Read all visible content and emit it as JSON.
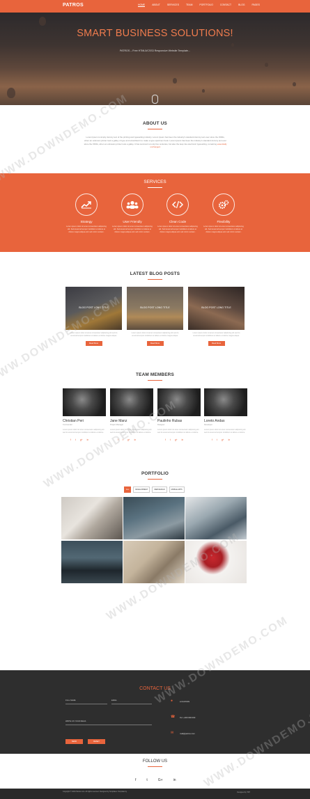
{
  "nav": {
    "logo": "PATROS",
    "links": [
      "HOME",
      "ABOUT",
      "SERVICES",
      "TEAM",
      "PORTFOLIO",
      "CONTACT",
      "BLOG",
      "PAGES"
    ]
  },
  "hero": {
    "title": "SMART BUSINESS SOLUTIONS!",
    "subtitle": "PATROS – Free HTML5/CSS3 Responsive Website Template..."
  },
  "about": {
    "title": "ABOUT US",
    "text": "Lorem Ipsum is simply dummy text of the printing and typesetting industry. Lorem Ipsum has been the industry's standard dummy text ever since the 1500s, when an unknown printer took a galley of type and scrambled it to make a type specimen book. Lorem Ipsum has been the industry's standard dummy text ever since the 1500s, when an unknown printer took a galley. It has survived not only five centuries, but also the leap into electronic typesetting, remaining",
    "link": "essentially unchanged."
  },
  "services": {
    "title": "SERVICES",
    "items": [
      {
        "icon": "chart-line-icon",
        "title": "Strategy",
        "text": "Lorem ipsum dolor sit amet consectetur adipiscing elit. Sed eiusmod tempor incididunt ut labore et dolore magna aliqua enim ad minim veniam."
      },
      {
        "icon": "users-icon",
        "title": "User Friendly",
        "text": "Lorem ipsum dolor sit amet consectetur adipiscing elit. Sed eiusmod tempor incididunt ut labore et dolore magna aliqua enim ad minim veniam."
      },
      {
        "icon": "code-icon",
        "title": "Clean Code",
        "text": "Lorem ipsum dolor sit amet consectetur adipiscing elit. Sed eiusmod tempor incididunt ut labore et dolore magna aliqua enim ad minim veniam."
      },
      {
        "icon": "gears-icon",
        "title": "Flexibility",
        "text": "Lorem ipsum dolor sit amet consectetur adipiscing elit. Sed eiusmod tempor incididunt ut labore et dolore magna aliqua enim ad minim veniam."
      }
    ]
  },
  "blog": {
    "title": "LATEST BLOG POSTS",
    "posts": [
      {
        "title": "BLOG POST LONG TITLE",
        "text": "Lorem ipsum dolor sit amet consectetur adipiscing elit sed do eiusmod tempor incididunt ut labore et dolore magna aliqua.",
        "button": "Read More"
      },
      {
        "title": "BLOG POST LONG TITLE",
        "text": "Lorem ipsum dolor sit amet consectetur adipiscing elit sed do eiusmod tempor incididunt ut labore et dolore magna aliqua.",
        "button": "Read More"
      },
      {
        "title": "BLOG POST LONG TITLE",
        "text": "Lorem ipsum dolor sit amet consectetur adipiscing elit sed do eiusmod tempor incididunt ut labore et dolore magna aliqua.",
        "button": "Read More"
      }
    ]
  },
  "team": {
    "title": "TEAM MEMBERS",
    "members": [
      {
        "name": "Christian Peri",
        "role": "Co-Founder",
        "text": "Lorem ipsum dolor sit amet consectetur adipiscing elit sed do eiusmod tempor incididunt ut labore et dolore."
      },
      {
        "name": "Jane Manz",
        "role": "Project Manager",
        "text": "Lorem ipsum dolor sit amet consectetur adipiscing elit sed do eiusmod tempor incididunt ut labore et dolore."
      },
      {
        "name": "Paulinho Rubas",
        "role": "Designer",
        "text": "Lorem ipsum dolor sit amet consectetur adipiscing elit sed do eiusmod tempor incididunt ut labore et dolore."
      },
      {
        "name": "Loreto Andas",
        "role": "Developer",
        "text": "Lorem ipsum dolor sit amet consectetur adipiscing elit sed do eiusmod tempor incididunt ut labore et dolore."
      }
    ]
  },
  "portfolio": {
    "title": "PORTFOLIO",
    "tabs": [
      "ALL",
      "DEVELOPMENT",
      "WEB DESIGN",
      "MOBILE APPS"
    ]
  },
  "contact": {
    "title": "CONTACT US",
    "fullname_placeholder": "FULL NAME",
    "email_placeholder": "EMAIL",
    "message_placeholder": "WRITE US YOUR IDEAS",
    "send_label": "SEND",
    "reset_label": "RESET",
    "location": "LOCATION",
    "phone": "Tel: +000 000 000",
    "email": "mail@patros.com"
  },
  "follow": {
    "title": "FOLLOW US"
  },
  "footer": {
    "copyright": "Copyright © 2016 Patros.com. All rights reserved. Designed by Templates. Template by",
    "right": "Designed by TFH"
  },
  "watermark": "WWW.DOWNDEMO.COM",
  "colors": {
    "accent": "#e8643c",
    "dark": "#2e2e2e"
  }
}
